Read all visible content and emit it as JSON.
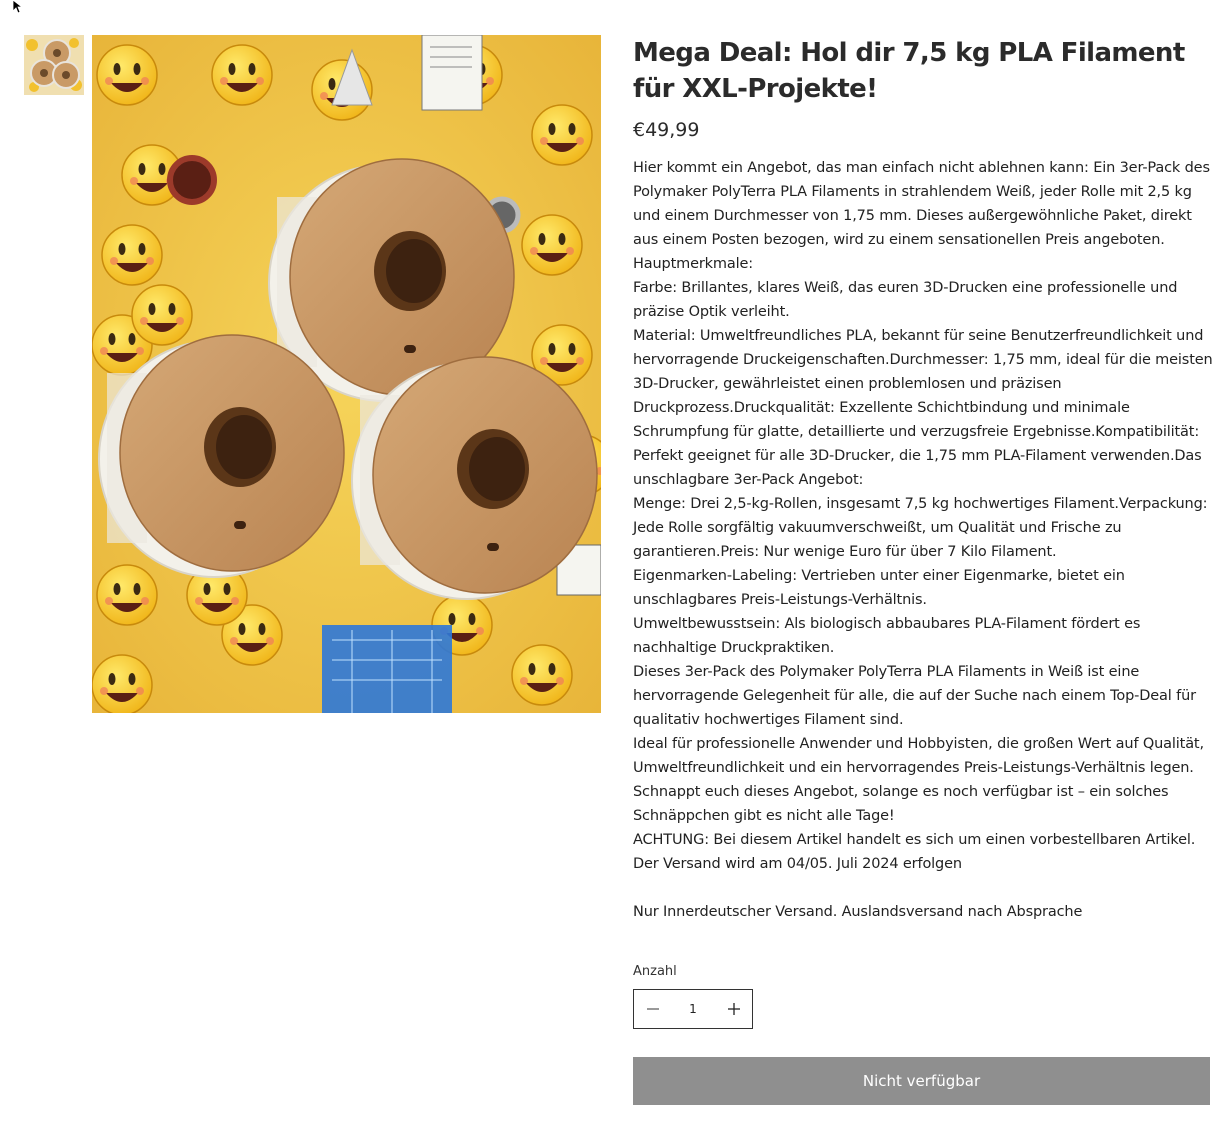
{
  "product": {
    "title": "Mega Deal: Hol dir 7,5 kg PLA Filament für XXL-Projekte!",
    "price": "€49,99",
    "description_lines": [
      "Hier kommt ein Angebot, das man einfach nicht ablehnen kann: Ein 3er-Pack des Polymaker PolyTerra PLA Filaments in strahlendem Weiß, jeder Rolle mit 2,5 kg und einem Durchmesser von 1,75 mm. Dieses außergewöhnliche Paket, direkt aus einem Posten bezogen, wird zu einem sensationellen Preis angeboten.",
      "Hauptmerkmale:",
      "Farbe: Brillantes, klares Weiß, das euren 3D-Drucken eine professionelle und präzise Optik verleiht.",
      "Material: Umweltfreundliches PLA, bekannt für seine Benutzerfreundlichkeit und hervorragende Druckeigenschaften.Durchmesser: 1,75 mm, ideal für die meisten 3D-Drucker, gewährleistet einen problemlosen und präzisen Druckprozess.Druckqualität: Exzellente Schichtbindung und minimale Schrumpfung für glatte, detaillierte und verzugsfreie Ergebnisse.Kompatibilität: Perfekt geeignet für alle 3D-Drucker, die 1,75 mm PLA-Filament verwenden.Das unschlagbare 3er-Pack Angebot:",
      "Menge: Drei 2,5-kg-Rollen, insgesamt 7,5 kg hochwertiges Filament.Verpackung: Jede Rolle sorgfältig vakuumverschweißt, um Qualität und Frische zu garantieren.Preis: Nur wenige Euro für über 7 Kilo Filament.",
      "Eigenmarken-Labeling: Vertrieben unter einer Eigenmarke, bietet ein unschlagbares Preis-Leistungs-Verhältnis.",
      "Umweltbewusstsein: Als biologisch abbaubares PLA-Filament fördert es nachhaltige Druckpraktiken.",
      "Dieses 3er-Pack des Polymaker PolyTerra PLA Filaments in Weiß ist eine hervorragende Gelegenheit für alle, die auf der Suche nach einem Top-Deal für qualitativ hochwertiges Filament sind.",
      "Ideal für professionelle Anwender und Hobbyisten, die großen Wert auf Qualität, Umweltfreundlichkeit und ein hervorragendes Preis-Leistungs-Verhältnis legen. Schnappt euch dieses Angebot, solange es noch verfügbar ist – ein solches Schnäppchen gibt es nicht alle Tage!",
      "ACHTUNG: Bei diesem Artikel handelt es sich um einen vorbestellbaren Artikel. Der Versand wird am 04/05. Juli 2024 erfolgen"
    ],
    "shipping_note": "Nur Innerdeutscher Versand. Auslandsversand nach Absprache"
  },
  "quantity": {
    "label": "Anzahl",
    "value": "1"
  },
  "buy_button": {
    "label": "Nicht verfügbar"
  },
  "colors": {
    "button_disabled": "#8f8f8f",
    "spool_cardboard": "#c99a66",
    "background_yellow": "#f2c12e"
  },
  "icons": {
    "cursor": "arrow-cursor-icon",
    "minus": "minus-icon",
    "plus": "plus-icon"
  }
}
